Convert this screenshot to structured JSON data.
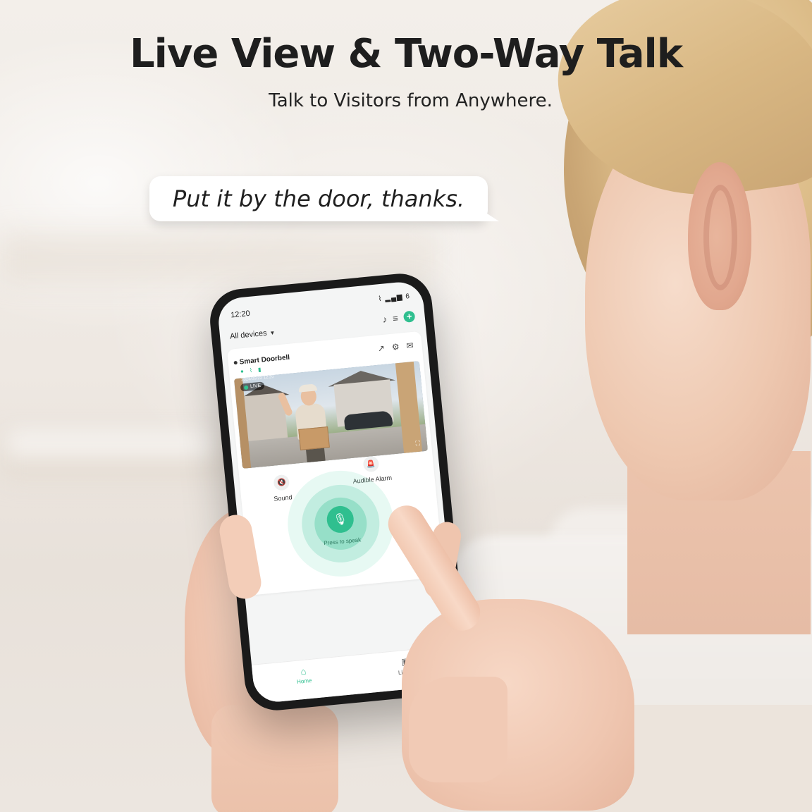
{
  "banner": {
    "title": "Live View & Two-Way Talk",
    "subtitle": "Talk to Visitors from Anywhere.",
    "speech_bubble": "Put it by the door, thanks."
  },
  "phone": {
    "status_bar": {
      "time": "12:20",
      "icons": "⌇ ▂▄▆ 6"
    },
    "header": {
      "device_filter": "All devices",
      "bell_icon": "♪",
      "list_icon": "≡",
      "add_icon": "+"
    },
    "device_card": {
      "name": "Smart Doorbell",
      "status_icons": "● ⌇ ▮",
      "share_icon": "↗",
      "settings_icon": "⚙",
      "message_icon": "✉",
      "live_badge": "LIVE",
      "timestamp": "2024/05/22 12:20",
      "fullscreen_icon": "⛶"
    },
    "controls": {
      "sound_label": "Sound",
      "sound_icon": "🔇",
      "alarm_label": "Audible Alarm",
      "alarm_icon": "🚨",
      "talk_label": "Press to speak",
      "mic_icon": "🎙"
    },
    "tabbar": {
      "home_label": "Home",
      "home_icon": "⌂",
      "library_label": "Library",
      "library_icon": "▣"
    }
  },
  "colors": {
    "accent": "#2fbf8f",
    "headline": "#1e1e1e"
  }
}
